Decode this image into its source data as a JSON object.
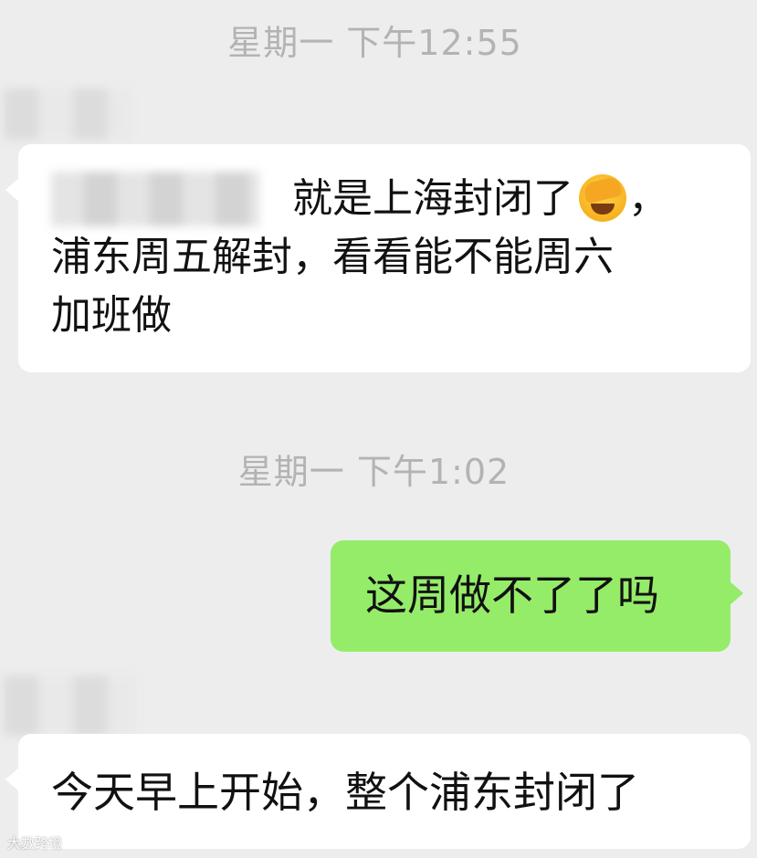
{
  "timestamps": [
    "星期一 下午12:55",
    "星期一 下午1:02"
  ],
  "messages": [
    {
      "side": "incoming",
      "line1": "就是上海封闭了",
      "line1_tail": "，",
      "line2": "浦东周五解封，看看能不能周六",
      "line3": "加班做",
      "emoji": "facepalm-laughing-emoji"
    },
    {
      "side": "outgoing",
      "text": "这周做不了了吗"
    },
    {
      "side": "incoming",
      "text": "今天早上开始，整个浦东封闭了"
    }
  ],
  "watermark": "大數跨境",
  "colors": {
    "background": "#ededed",
    "incoming_bubble": "#ffffff",
    "outgoing_bubble": "#95ec69",
    "timestamp": "#b3b3b3"
  }
}
